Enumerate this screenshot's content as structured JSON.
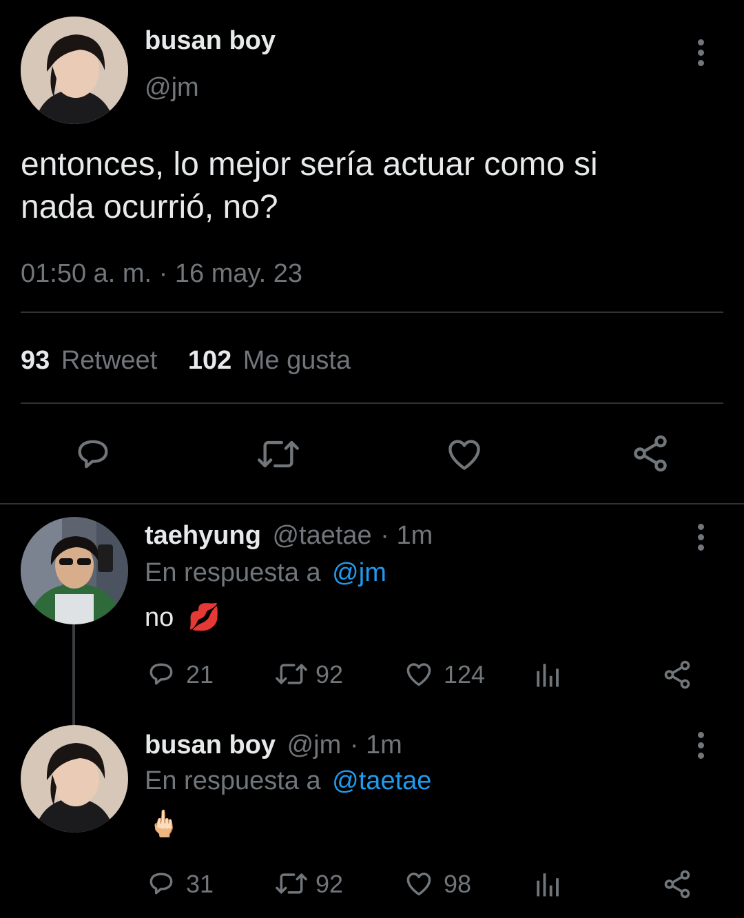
{
  "main_tweet": {
    "name": "busan boy",
    "handle": "@jm",
    "text_line1": "entonces, lo mejor sería actuar como si",
    "text_line2": "nada ocurrió, no?",
    "timestamp": "01:50 a. m. · 16 may. 23",
    "retweet_count": "93",
    "retweet_label": "Retweet",
    "like_count": "102",
    "like_label": "Me gusta"
  },
  "replies": [
    {
      "name": "taehyung",
      "handle": "@taetae",
      "time": "· 1m",
      "reply_prefix": "En respuesta a",
      "reply_to": "@jm",
      "text": "no",
      "emoji": "💋",
      "reply_count": "21",
      "retweet_count": "92",
      "like_count": "124"
    },
    {
      "name": "busan boy",
      "handle": "@jm",
      "time": "· 1m",
      "reply_prefix": "En respuesta a",
      "reply_to": "@taetae",
      "emoji": "🖕🏻",
      "reply_count": "31",
      "retweet_count": "92",
      "like_count": "98"
    }
  ],
  "icons": {
    "reply": "reply-icon",
    "retweet": "retweet-icon",
    "like": "heart-icon",
    "share": "share-icon",
    "analytics": "analytics-icon",
    "more": "more-icon"
  },
  "colors": {
    "background": "#000000",
    "text": "#e7e9ea",
    "secondary": "#71767b",
    "link": "#1d9bf0",
    "divider": "#2f3336"
  }
}
